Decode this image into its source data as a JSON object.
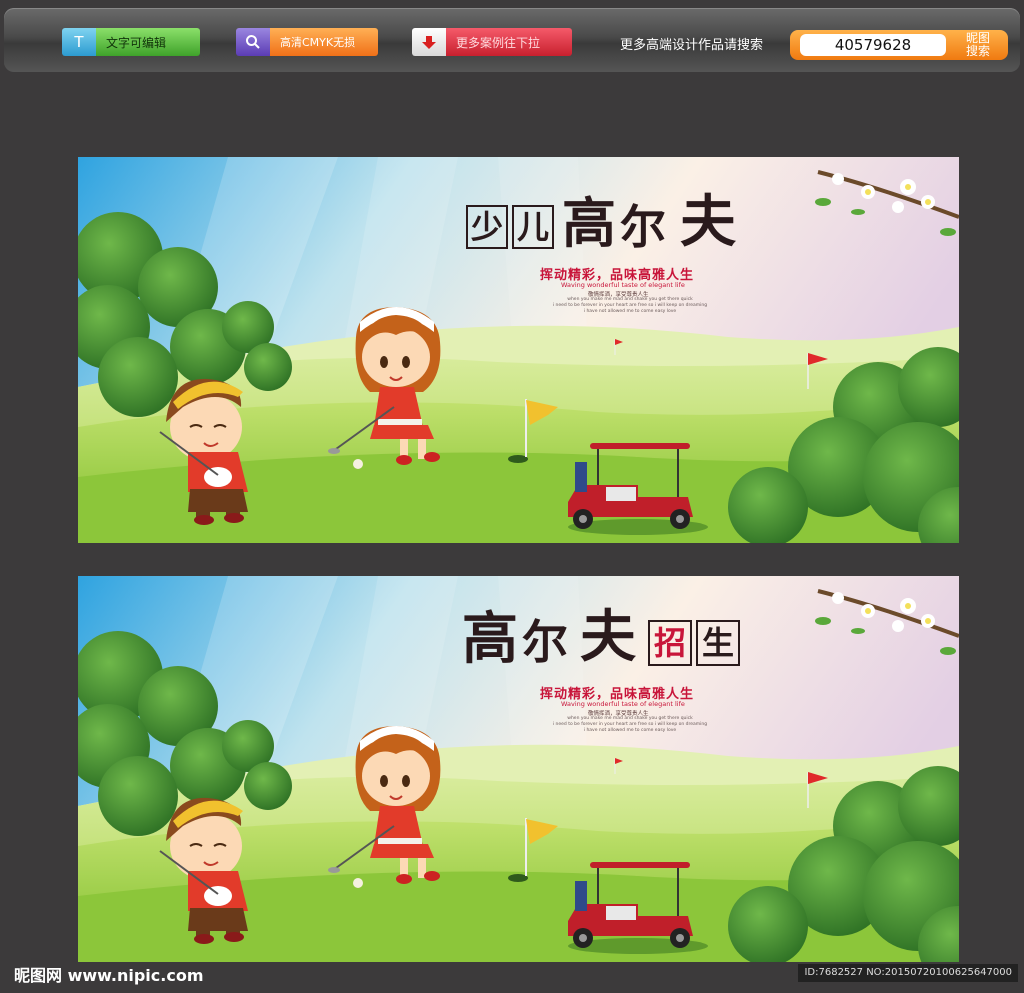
{
  "toolbar": {
    "btn_text_icon": "T",
    "btn_text_label": "文字可编辑",
    "btn_hd_icon": "search-icon",
    "btn_hd_label": "高清CMYK无损",
    "btn_more_icon": "down-arrow-icon",
    "btn_more_label": "更多案例往下拉",
    "search_prompt": "更多高端设计作品请搜索",
    "search_value": "40579628",
    "search_button": "昵图\n搜索",
    "search_button_line1": "昵图",
    "search_button_line2": "搜索"
  },
  "poster1": {
    "title": [
      "少",
      "儿",
      "高",
      "尔",
      "夫"
    ],
    "slogan": "挥动精彩，品味高雅人生",
    "slogan_en": "Waving wonderful taste of elegant life",
    "slogan_sub": "敬情挥洒，享受尊贵人生",
    "small_text_1": "when you make me mad and shake you get there quick",
    "small_text_2": "i need to be forever in your heart are free so i will keep on dreaming",
    "small_text_3": "i have not allowed me to come easy love"
  },
  "poster2": {
    "title": [
      "高",
      "尔",
      "夫",
      "招",
      "生"
    ],
    "slogan": "挥动精彩，品味高雅人生",
    "slogan_en": "Waving wonderful taste of elegant life",
    "slogan_sub": "敬情挥洒，享受尊贵人生",
    "small_text_1": "when you make me mad and shake you get there quick",
    "small_text_2": "i need to be forever in your heart are free so i will keep on dreaming",
    "small_text_3": "i have not allowed me to come easy love"
  },
  "footer": {
    "logo": "昵图网 www.nipic.com",
    "id": "ID:7682527 NO:20150720100625647000"
  },
  "colors": {
    "background": "#3c3a3b",
    "slogan": "#c8153a",
    "grass": "#9ccc3c",
    "sky": "#3aa8e0",
    "tree": "#3f8a2c"
  }
}
